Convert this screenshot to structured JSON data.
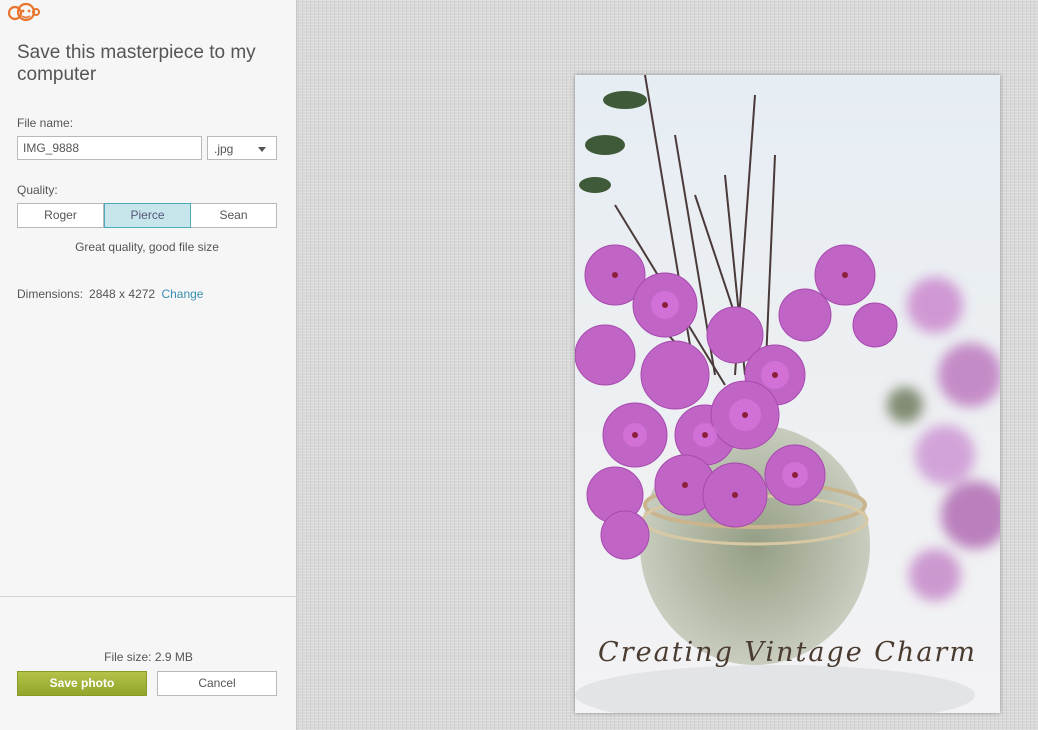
{
  "sidebar": {
    "title": "Save this masterpiece to my computer",
    "file_name_label": "File name:",
    "file_name_value": "IMG_9888",
    "extension": ".jpg",
    "quality_label": "Quality:",
    "quality_options": [
      "Roger",
      "Pierce",
      "Sean"
    ],
    "quality_selected": "Pierce",
    "quality_description": "Great quality, good file size",
    "dimensions_label": "Dimensions:",
    "dimensions_value": "2848 x 4272",
    "change_link": "Change",
    "file_size": "File size: 2.9 MB",
    "save_label": "Save photo",
    "cancel_label": "Cancel"
  },
  "photo": {
    "watermark": "Creating Vintage Charm"
  },
  "colors": {
    "accent_green": "#a3b339",
    "selected_blue": "#c6e6ec",
    "link": "#3a8fb0",
    "logo_orange": "#e8752e"
  },
  "icons": {
    "logo": "monkey-logo-icon",
    "dropdown": "chevron-down-icon"
  }
}
